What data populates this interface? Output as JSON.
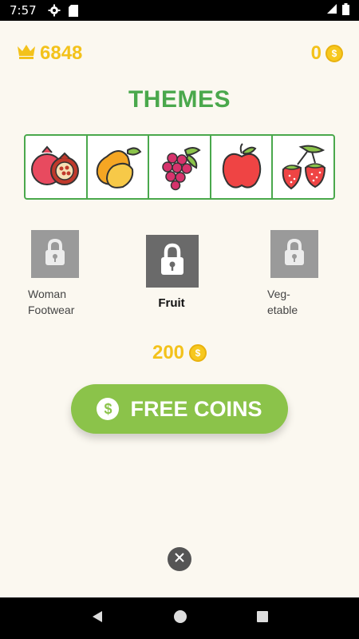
{
  "status_bar": {
    "time": "7:57"
  },
  "header": {
    "score": "6848",
    "coins": "0"
  },
  "page": {
    "title": "THEMES"
  },
  "fruits": [
    "pomegranate-icon",
    "mango-icon",
    "raspberry-icon",
    "apple-icon",
    "strawberry-icon"
  ],
  "themes": [
    {
      "label": "Woman\nFootwear",
      "locked": true
    },
    {
      "label": "Fruit",
      "locked": true,
      "selected": true
    },
    {
      "label": "Veg-\netable",
      "locked": true
    }
  ],
  "price": "200",
  "free_button": {
    "label": "FREE COINS"
  },
  "colors": {
    "accent_green": "#4aa84c",
    "button_green": "#8bc34a",
    "gold": "#f3c21b"
  }
}
